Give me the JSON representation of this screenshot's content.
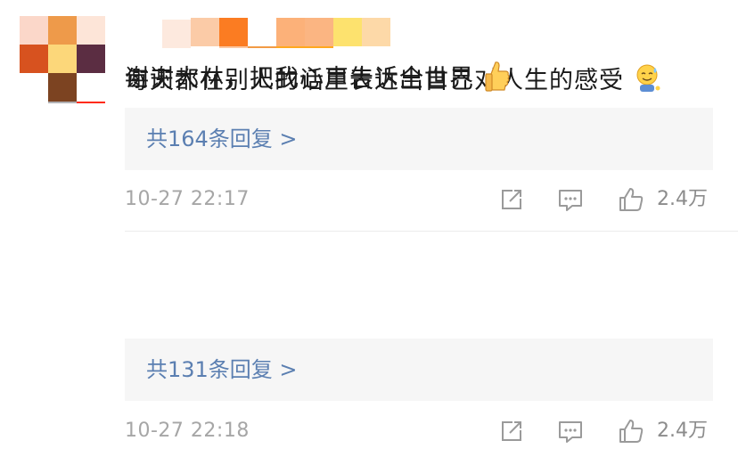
{
  "comments": [
    {
      "text": "每天都在别人的话里表达出自己对人生的感受",
      "emoji": "sweat-smile-emoji",
      "reply_label": "共164条回复 >",
      "time": "10-27 22:17",
      "likes": "2.4万",
      "avatar_colors": [
        "#f2c2c8",
        "#dedede",
        "#d2d2d2",
        "#ffffff",
        "#9a9aa0",
        "#a7a7ab",
        "#ffffff",
        "#b1b1b4",
        "#ff2a10"
      ],
      "name_colors": [
        "#fde9de",
        "#ffffff",
        "#fbc7a2",
        "#f29b45",
        "#ffa81f"
      ]
    },
    {
      "text": "谢谢大林，把我心声告诉全世界",
      "emoji": "thumbs-up-emoji",
      "reply_label": "共131条回复 >",
      "time": "10-27 22:18",
      "likes": "2.4万",
      "avatar_colors": [
        "#fbd7c9",
        "#ee9a4a",
        "#fde5d8",
        "#d7521f",
        "#fcd77a",
        "#5b2d42",
        "#ffffff",
        "#7c4321",
        "#ffffff"
      ],
      "name_colors": [
        "#fbcba7",
        "#fb7c22",
        "#ffffff",
        "#fcb179",
        "#fbb582",
        "#fde26e",
        "#fdd9a8"
      ]
    }
  ],
  "colors": {
    "link": "#5b7fb1",
    "meta_text": "#a6a6a6",
    "icon": "#9a9a9a"
  }
}
